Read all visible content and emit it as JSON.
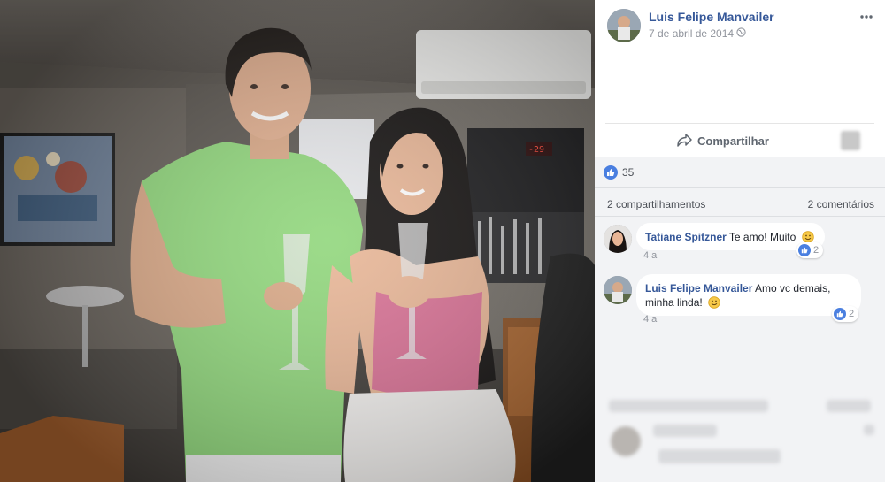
{
  "post": {
    "author": "Luis Felipe Manvailer",
    "date": "7 de abril de 2014 ·",
    "privacy_icon": "globe-icon",
    "more_icon": "more-options-icon"
  },
  "actions": {
    "share_label": "Compartilhar"
  },
  "feedback": {
    "reaction_count": "35",
    "shares_label": "2 compartilhamentos",
    "comments_label": "2 comentários"
  },
  "comments": [
    {
      "author": "Tatiane Spitzner",
      "text": "Te amo! Muito",
      "emoji": "smiley",
      "likes": "2",
      "time": "4 a"
    },
    {
      "author": "Luis Felipe Manvailer",
      "text": "Amo vc demais, minha linda!",
      "emoji": "smiley",
      "likes": "2",
      "time": "4 a"
    }
  ],
  "colors": {
    "link": "#365899",
    "like_blue": "#4a7fe0",
    "feedback_bg": "#f2f3f5",
    "shirt_green": "#8fd67a",
    "top_pink": "#d86f93"
  }
}
